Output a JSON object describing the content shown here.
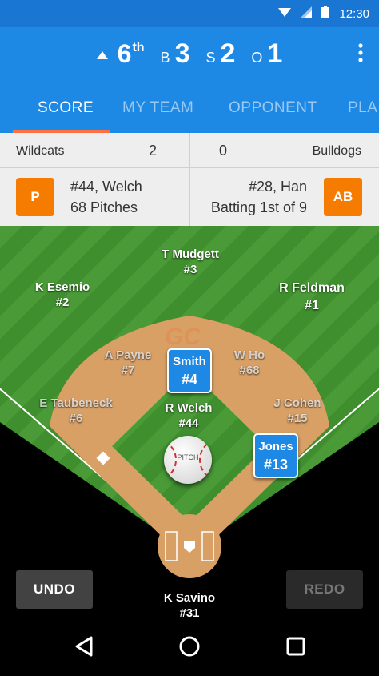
{
  "status_bar": {
    "time": "12:30"
  },
  "header": {
    "inning": "6",
    "inning_suffix": "th",
    "balls_label": "B",
    "balls": "3",
    "strikes_label": "S",
    "strikes": "2",
    "outs_label": "O",
    "outs": "1"
  },
  "tabs": [
    {
      "label": "SCORE",
      "active": true
    },
    {
      "label": "MY TEAM",
      "active": false
    },
    {
      "label": "OPPONENT",
      "active": false
    },
    {
      "label": "PLA",
      "active": false
    }
  ],
  "scoreboard": {
    "home_team": "Wildcats",
    "home_score": "2",
    "away_score": "0",
    "away_team": "Bulldogs",
    "pitcher_badge": "P",
    "pitcher_line1": "#44, Welch",
    "pitcher_line2": "68 Pitches",
    "batter_line1": "#28, Han",
    "batter_line2": "Batting 1st of 9",
    "batter_badge": "AB"
  },
  "field": {
    "logo": "GC",
    "pitch_label": "PITCH",
    "players": {
      "cf": {
        "name": "T Mudgett",
        "number": "#3"
      },
      "lf": {
        "name": "K Esemio",
        "number": "#2"
      },
      "rf": {
        "name": "R Feldman",
        "number": "#1"
      },
      "ss": {
        "name": "A Payne",
        "number": "#7"
      },
      "second": {
        "name": "W Ho",
        "number": "#68"
      },
      "third": {
        "name": "E Taubeneck",
        "number": "#6"
      },
      "first": {
        "name": "J Cohen",
        "number": "#15"
      },
      "pitcher": {
        "name": "R Welch",
        "number": "#44"
      },
      "catcher": {
        "name": "K Savino",
        "number": "#31"
      }
    },
    "runners": {
      "second": {
        "name": "Smith",
        "number": "#4"
      },
      "first": {
        "name": "Jones",
        "number": "#13"
      }
    },
    "undo_label": "UNDO",
    "redo_label": "REDO"
  },
  "colors": {
    "primary": "#1E88E5",
    "primary_dark": "#1976D2",
    "accent": "#F57C00",
    "tab_indicator": "#FF7043",
    "grass": "#3E8E2E",
    "dirt": "#D9A066"
  }
}
